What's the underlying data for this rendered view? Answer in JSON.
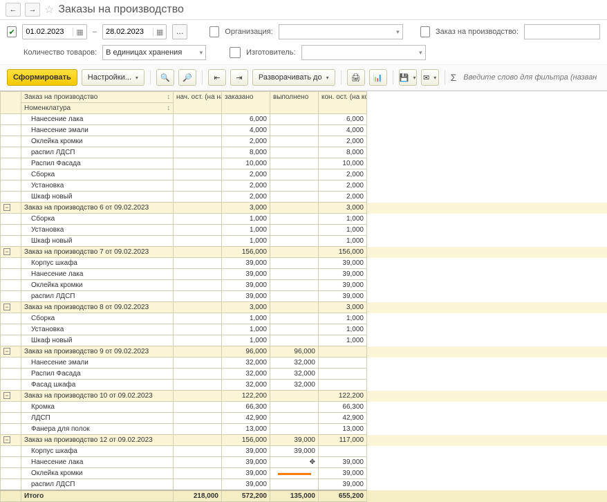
{
  "title": "Заказы на производство",
  "nav": {
    "back": "←",
    "forward": "→",
    "star": "☆"
  },
  "filters": {
    "date_from": "01.02.2023",
    "date_to": "28.02.2023",
    "dash": "–",
    "qty_label": "Количество товаров:",
    "qty_value": "В единицах хранения",
    "org_label": "Организация:",
    "mfr_label": "Изготовитель:",
    "order_label": "Заказ на производство:"
  },
  "toolbar": {
    "form": "Сформировать",
    "settings": "Настройки...",
    "expand": "Разворачивать до",
    "filter_placeholder": "Введите слово для фильтра (название тов",
    "sigma": "Σ"
  },
  "headers": {
    "order": "Заказ на производство",
    "nomen": "Номенклатура",
    "beg": "нач. ост. (на начало)",
    "ordered": "заказано",
    "done": "выполнено",
    "end": "кон. ост. (на конец)"
  },
  "groups": [
    {
      "name": "",
      "rows": [
        {
          "name": "Нанесение лака",
          "ordered": "6,000",
          "end": "6,000"
        },
        {
          "name": "Нанесение эмали",
          "ordered": "4,000",
          "end": "4,000"
        },
        {
          "name": "Оклейка кромки",
          "ordered": "2,000",
          "end": "2,000"
        },
        {
          "name": "распил ЛДСП",
          "ordered": "8,000",
          "end": "8,000"
        },
        {
          "name": "Распил Фасада",
          "ordered": "10,000",
          "end": "10,000"
        },
        {
          "name": "Сборка",
          "ordered": "2,000",
          "end": "2,000"
        },
        {
          "name": "Установка",
          "ordered": "2,000",
          "end": "2,000"
        },
        {
          "name": "Шкаф новый",
          "ordered": "2,000",
          "end": "2,000"
        }
      ]
    },
    {
      "name": "Заказ на производство 6 от 09.02.2023",
      "ordered": "3,000",
      "end": "3,000",
      "rows": [
        {
          "name": "Сборка",
          "ordered": "1,000",
          "end": "1,000"
        },
        {
          "name": "Установка",
          "ordered": "1,000",
          "end": "1,000"
        },
        {
          "name": "Шкаф новый",
          "ordered": "1,000",
          "end": "1,000"
        }
      ]
    },
    {
      "name": "Заказ на производство 7 от 09.02.2023",
      "ordered": "156,000",
      "end": "156,000",
      "rows": [
        {
          "name": "Корпус шкафа",
          "ordered": "39,000",
          "end": "39,000"
        },
        {
          "name": "Нанесение лака",
          "ordered": "39,000",
          "end": "39,000"
        },
        {
          "name": "Оклейка кромки",
          "ordered": "39,000",
          "end": "39,000"
        },
        {
          "name": "распил ЛДСП",
          "ordered": "39,000",
          "end": "39,000"
        }
      ]
    },
    {
      "name": "Заказ на производство 8 от 09.02.2023",
      "ordered": "3,000",
      "end": "3,000",
      "rows": [
        {
          "name": "Сборка",
          "ordered": "1,000",
          "end": "1,000"
        },
        {
          "name": "Установка",
          "ordered": "1,000",
          "end": "1,000"
        },
        {
          "name": "Шкаф новый",
          "ordered": "1,000",
          "end": "1,000"
        }
      ]
    },
    {
      "name": "Заказ на производство 9 от 09.02.2023",
      "ordered": "96,000",
      "done": "96,000",
      "end": "",
      "rows": [
        {
          "name": "Нанесение эмали",
          "ordered": "32,000",
          "done": "32,000"
        },
        {
          "name": "Распил Фасада",
          "ordered": "32,000",
          "done": "32,000"
        },
        {
          "name": "Фасад шкафа",
          "ordered": "32,000",
          "done": "32,000"
        }
      ]
    },
    {
      "name": "Заказ на производство 10 от 09.02.2023",
      "ordered": "122,200",
      "end": "122,200",
      "rows": [
        {
          "name": "Кромка",
          "ordered": "66,300",
          "end": "66,300"
        },
        {
          "name": "ЛДСП",
          "ordered": "42,900",
          "end": "42,900"
        },
        {
          "name": "Фанера для полок",
          "ordered": "13,000",
          "end": "13,000"
        }
      ]
    },
    {
      "name": "Заказ на производство 12 от 09.02.2023",
      "ordered": "156,000",
      "done": "39,000",
      "end": "117,000",
      "rows": [
        {
          "name": "Корпус шкафа",
          "ordered": "39,000",
          "done": "39,000"
        },
        {
          "name": "Нанесение лака",
          "ordered": "39,000",
          "cursor": true,
          "end": "39,000"
        },
        {
          "name": "Оклейка кромки",
          "ordered": "39,000",
          "mark": true,
          "end": "39,000"
        },
        {
          "name": "распил ЛДСП",
          "ordered": "39,000",
          "end": "39,000"
        }
      ]
    }
  ],
  "totals": {
    "label": "Итого",
    "beg": "218,000",
    "ordered": "572,200",
    "done": "135,000",
    "end": "655,200"
  }
}
